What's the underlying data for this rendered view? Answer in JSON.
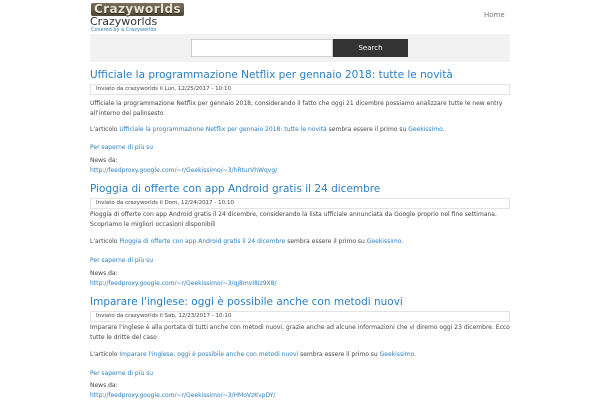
{
  "header": {
    "logo_text": "Crazyworlds",
    "site_title": "Crazyworlds",
    "site_subtitle": "Covered by a Crazyworlds",
    "nav_home": "Home"
  },
  "search": {
    "placeholder": "",
    "button_label": "Search"
  },
  "posts": [
    {
      "title": "Ufficiale la programmazione Netflix per gennaio 2018: tutte le novità",
      "meta": "Inviato da crazyworlds il Lun, 12/25/2017 - 10:10",
      "excerpt": "Ufficiale la programmazione Netflix per gennaio 2018, considerando il fatto che oggi 21 dicembre possiamo analizzare tutte le new entry all'interno del palinsesto",
      "source_prefix": "L'articolo",
      "source_link": "Ufficiale la programmazione Netflix per gennaio 2018: tutte le novità",
      "source_middle": "sembra essere il primo su",
      "source_site": "Geekissimo",
      "more": "Per saperne di più su",
      "news_label": "News da:",
      "news_url": "http://feedproxy.google.com/~r/Geekissimo/~3/hRturVhWqvg/"
    },
    {
      "title": "Pioggia di offerte con app Android gratis il 24 dicembre",
      "meta": "Inviato da crazyworlds il Dom, 12/24/2017 - 10:10",
      "excerpt": "Pioggia di offerte con app Android gratis il 24 dicembre, considerando la lista ufficiale annunciata da Google proprio nel fine settimana. Scopriamo le migliori occasioni disponibili",
      "source_prefix": "L'articolo",
      "source_link": "Pioggia di offerte con app Android gratis il 24 dicembre",
      "source_middle": "sembra essere il primo su",
      "source_site": "Geekissimo",
      "more": "Per saperne di più su",
      "news_label": "News da:",
      "news_url": "http://feedproxy.google.com/~r/Geekissimo/~3/qj8mvI8Iz9X8/"
    },
    {
      "title": "Imparare l'inglese: oggi è possibile anche con metodi nuovi",
      "meta": "Inviato da crazyworlds il Sab, 12/23/2017 - 10:10",
      "excerpt": "Imparare l'inglese è alla portata di tutti anche con metodi nuovi, grazie anche ad alcune informazioni che vi diremo oggi 23 dicembre. Ecco tutte le dritte del caso",
      "source_prefix": "L'articolo",
      "source_link": "Imparare l'inglese: oggi è possibile anche con metodi nuovi",
      "source_middle": "sembra essere il primo su",
      "source_site": "Geekissimo",
      "more": "Per saperne di più su",
      "news_label": "News da:",
      "news_url": "http://feedproxy.google.com/~r/Geekissimo/~3/HMoVzKvpDY/"
    }
  ]
}
